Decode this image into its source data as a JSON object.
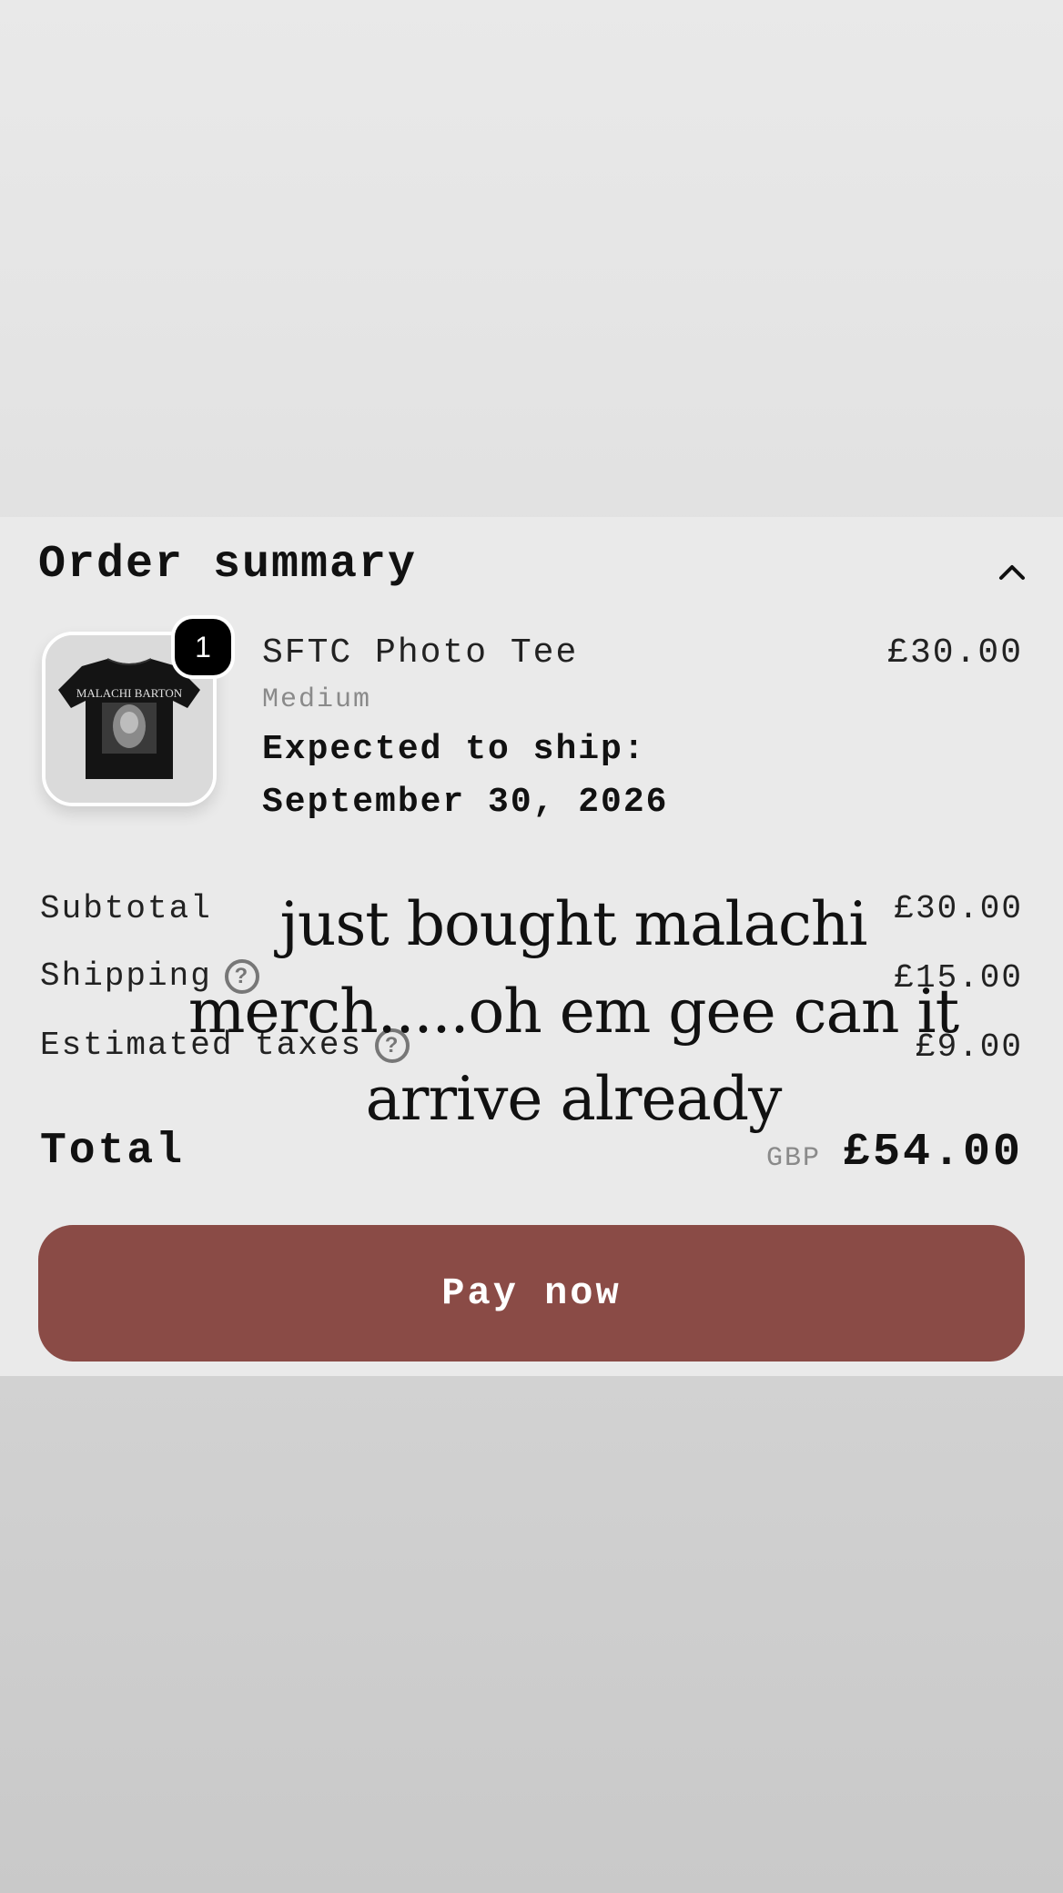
{
  "order_summary": {
    "title": "Order summary",
    "collapse_icon": "chevron-up-icon"
  },
  "item": {
    "quantity": "1",
    "name": "SFTC Photo Tee",
    "price": "£30.00",
    "variant": "Medium",
    "ship_label": "Expected to ship:",
    "ship_date": "September 30, 2026",
    "image_print": "MALACHI BARTON"
  },
  "costs": {
    "subtotal_label": "Subtotal",
    "subtotal_value": "£30.00",
    "shipping_label": "Shipping",
    "shipping_value": "£15.00",
    "taxes_label": "Estimated taxes",
    "taxes_value": "£9.00",
    "total_label": "Total",
    "total_currency": "GBP",
    "total_value": "£54.00"
  },
  "pay_button_label": "Pay now",
  "caption": {
    "text": "just bought malachi merch.....oh em gee can it arrive already"
  },
  "colors": {
    "pay_button": "#8a4b46",
    "card_background": "#eaeaea",
    "badge": "#000000"
  }
}
